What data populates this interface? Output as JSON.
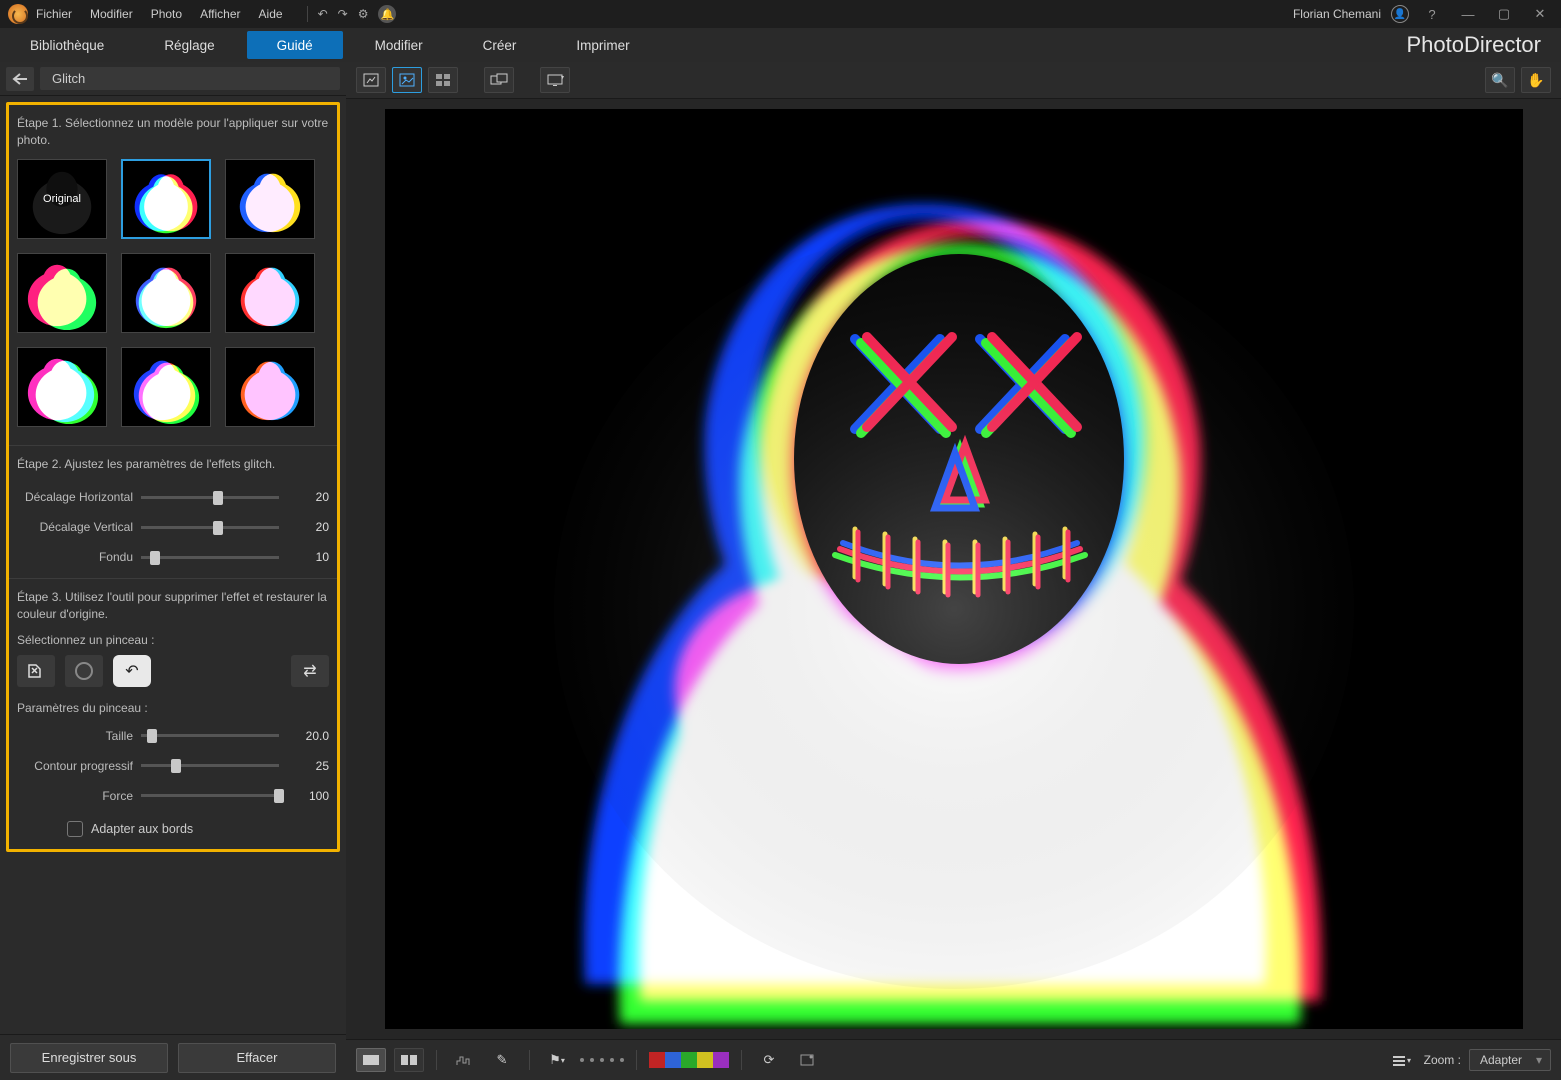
{
  "titlebar": {
    "menus": [
      "Fichier",
      "Modifier",
      "Photo",
      "Afficher",
      "Aide"
    ],
    "username": "Florian Chemani"
  },
  "modebar": {
    "tabs": [
      "Bibliothèque",
      "Réglage",
      "Guidé",
      "Modifier",
      "Créer",
      "Imprimer"
    ],
    "active_index": 2,
    "brand": "PhotoDirector"
  },
  "sidebar": {
    "crumb_title": "Glitch",
    "steps": {
      "step1": "Étape 1. Sélectionnez un modèle pour l'appliquer sur votre photo.",
      "step2": "Étape 2. Ajustez les paramètres de l'effets glitch.",
      "step3": "Étape 3. Utilisez l'outil pour supprimer l'effet et restaurer la couleur d'origine."
    },
    "thumbnails": {
      "original_label": "Original",
      "selected_index": 1,
      "count": 9
    },
    "sliders_effect": [
      {
        "label": "Décalage Horizontal",
        "value": "20",
        "pct": 56
      },
      {
        "label": "Décalage Vertical",
        "value": "20",
        "pct": 56
      },
      {
        "label": "Fondu",
        "value": "10",
        "pct": 10
      }
    ],
    "brush_section_label": "Sélectionnez un pinceau :",
    "brush_params_label": "Paramètres du pinceau :",
    "sliders_brush": [
      {
        "label": "Taille",
        "value": "20.0",
        "pct": 8
      },
      {
        "label": "Contour progressif",
        "value": "25",
        "pct": 25
      },
      {
        "label": "Force",
        "value": "100",
        "pct": 100
      }
    ],
    "checkbox_label": "Adapter aux bords",
    "footer": {
      "save": "Enregistrer sous",
      "clear": "Effacer"
    }
  },
  "canvas_toolbar": {
    "view_modes": [
      "single",
      "fit",
      "grid",
      "compare",
      "display"
    ]
  },
  "footbar": {
    "swatches": [
      "#c02424",
      "#2e64d8",
      "#2aa82a",
      "#d0c020",
      "#9a2fbf"
    ],
    "zoom_label": "Zoom :",
    "zoom_value": "Adapter"
  }
}
